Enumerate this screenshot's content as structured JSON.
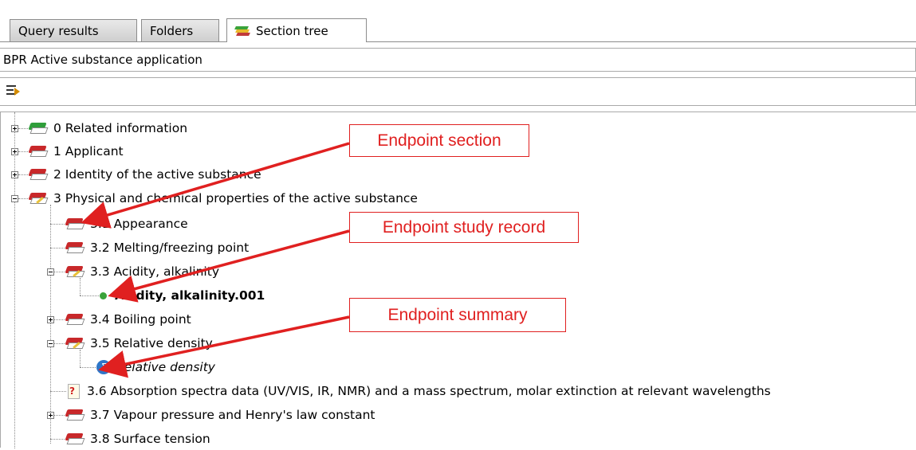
{
  "tabs": [
    {
      "label": "Query results",
      "active": false
    },
    {
      "label": "Folders",
      "active": false
    },
    {
      "label": "Section tree",
      "active": true
    }
  ],
  "info_bar": {
    "text": "BPR Active substance application"
  },
  "tree": {
    "rows": [
      {
        "label": "0 Related information"
      },
      {
        "label": "1 Applicant"
      },
      {
        "label": "2 Identity of the active substance"
      },
      {
        "label": "3 Physical and chemical properties of the active substance"
      },
      {
        "label": "3.1 Appearance"
      },
      {
        "label": "3.2 Melting/freezing point"
      },
      {
        "label": "3.3 Acidity, alkalinity"
      },
      {
        "label": "Acidity, alkalinity.001"
      },
      {
        "label": "3.4 Boiling point"
      },
      {
        "label": "3.5 Relative density"
      },
      {
        "label": "Relative density"
      },
      {
        "label": "3.6 Absorption spectra data (UV/VIS, IR, NMR) and a mass spectrum, molar extinction at relevant wavelengths"
      },
      {
        "label": "3.7 Vapour pressure and Henry's law constant"
      },
      {
        "label": "3.8 Surface tension"
      }
    ]
  },
  "callouts": {
    "section": "Endpoint section",
    "study_record": "Endpoint study record",
    "summary": "Endpoint summary"
  },
  "colors": {
    "accent_red": "#e02020",
    "book_red": "#c8282a",
    "book_green": "#2f9e3a",
    "status_green": "#3aa33a",
    "summary_blue": "#2e76c8"
  }
}
